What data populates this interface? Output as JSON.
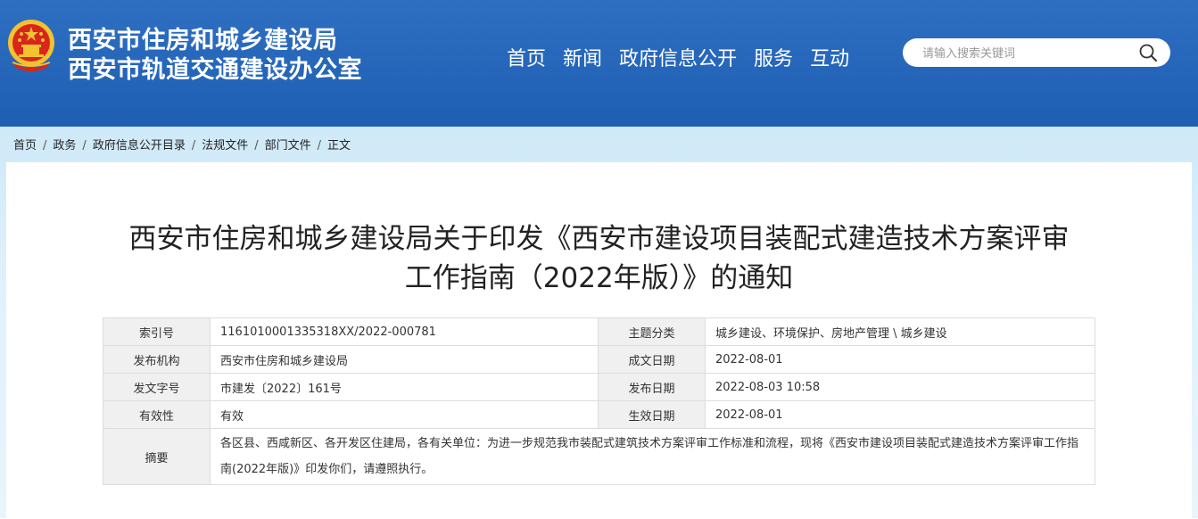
{
  "header": {
    "org_line1": "西安市住房和城乡建设局",
    "org_line2": "西安市轨道交通建设办公室",
    "emblem_icon": "national-emblem-icon",
    "bg_color": "#2565b8"
  },
  "nav": {
    "items": [
      "首页",
      "新闻",
      "政府信息公开",
      "服务",
      "互动"
    ]
  },
  "search": {
    "placeholder": "请输入搜索关键词",
    "icon": "search-icon"
  },
  "breadcrumb": [
    "首页",
    "政务",
    "政府信息公开目录",
    "法规文件",
    "部门文件",
    "正文"
  ],
  "article": {
    "title_line1": "西安市住房和城乡建设局关于印发《西安市建设项目装配式建造技术方案评审",
    "title_line2": "工作指南（2022年版）》的通知"
  },
  "meta": {
    "index_label": "索引号",
    "index_value": "1161010001335318XX/2022-000781",
    "topic_label": "主题分类",
    "topic_value": "城乡建设、环境保护、房地产管理 \\ 城乡建设",
    "issuer_label": "发布机构",
    "issuer_value": "西安市住房和城乡建设局",
    "created_label": "成文日期",
    "created_value": "2022-08-01",
    "docno_label": "发文字号",
    "docno_value": "市建发〔2022〕161号",
    "published_label": "发布日期",
    "published_value": "2022-08-03 10:58",
    "validity_label": "有效性",
    "validity_value": "有效",
    "effective_label": "生效日期",
    "effective_value": "2022-08-01",
    "abstract_label": "摘要",
    "abstract_value": "各区县、西咸新区、各开发区住建局，各有关单位：为进一步规范我市装配式建筑技术方案评审工作标准和流程，现将《西安市建设项目装配式建造技术方案评审工作指南(2022年版)》印发你们，请遵照执行。"
  }
}
